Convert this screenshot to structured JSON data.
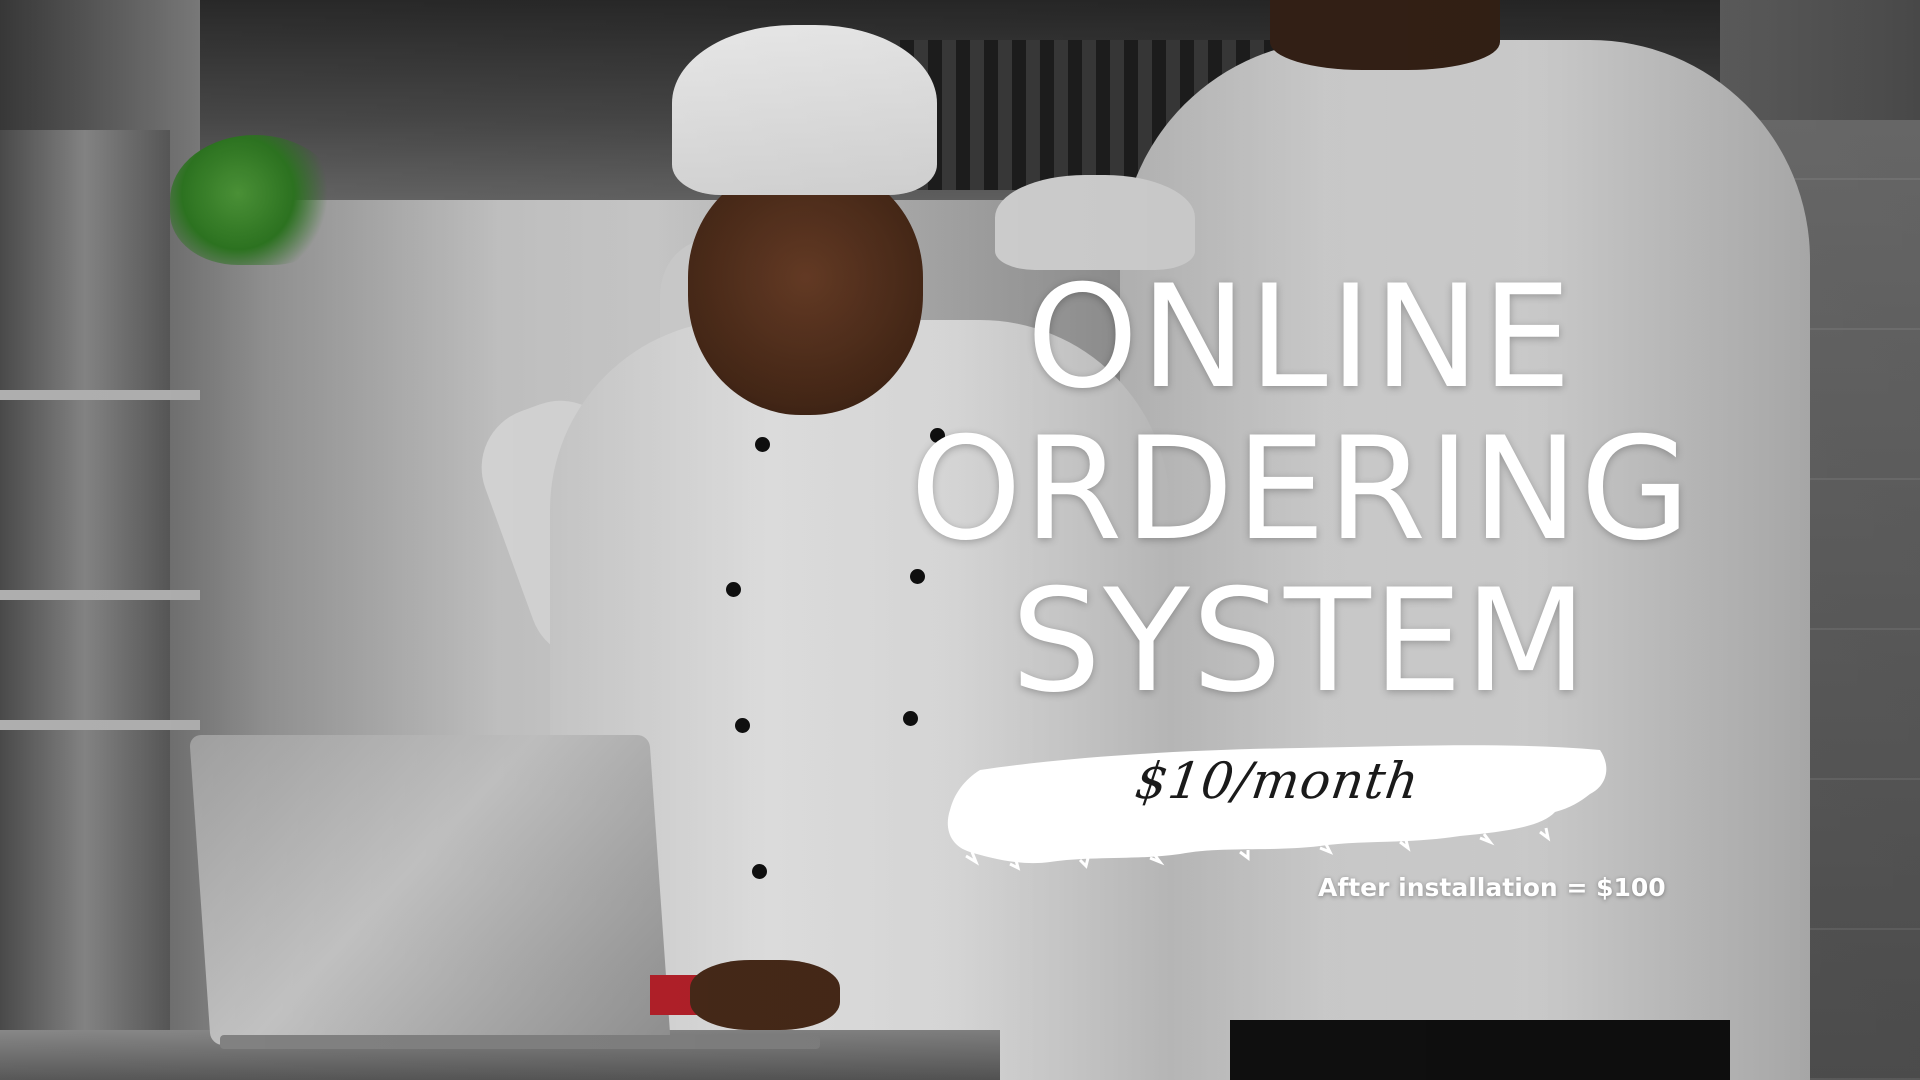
{
  "headline": {
    "line1": "ONLINE",
    "line2": "ORDERING",
    "line3": "SYSTEM"
  },
  "price_banner": {
    "price": "$10/month"
  },
  "note": {
    "text": "After installation = $100"
  },
  "colors": {
    "headline_text": "#ffffff",
    "banner_fill": "#ffffff",
    "banner_text": "#1a1a1a"
  }
}
